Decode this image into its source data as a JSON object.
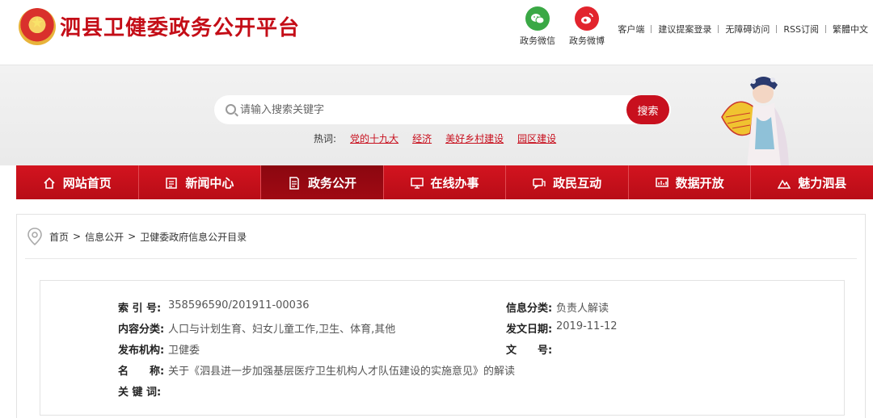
{
  "header": {
    "site_title": "泗县卫健委政务公开平台",
    "social": [
      {
        "label": "政务微信",
        "icon": "wechat-icon"
      },
      {
        "label": "政务微博",
        "icon": "weibo-icon"
      }
    ],
    "links": [
      "客户端",
      "建议提案登录",
      "无障碍访问",
      "RSS订阅",
      "繁體中文"
    ]
  },
  "search": {
    "placeholder": "请输入搜索关键字",
    "button_label": "搜索",
    "hot_label": "热词:",
    "hot_words": [
      "党的十九大",
      "经济",
      "美好乡村建设",
      "园区建设"
    ]
  },
  "nav": {
    "items": [
      {
        "label": "网站首页",
        "icon": "home-icon",
        "active": false
      },
      {
        "label": "新闻中心",
        "icon": "news-icon",
        "active": false
      },
      {
        "label": "政务公开",
        "icon": "document-icon",
        "active": true
      },
      {
        "label": "在线办事",
        "icon": "monitor-icon",
        "active": false
      },
      {
        "label": "政民互动",
        "icon": "chat-icon",
        "active": false
      },
      {
        "label": "数据开放",
        "icon": "data-icon",
        "active": false
      },
      {
        "label": "魅力泗县",
        "icon": "mountain-icon",
        "active": false
      }
    ]
  },
  "breadcrumb": {
    "items": [
      "首页",
      "信息公开",
      "卫健委政府信息公开目录"
    ],
    "separator": ">"
  },
  "meta": {
    "index_label": "索 引 号:",
    "index_value": "358596590/201911-00036",
    "category_label": "信息分类:",
    "category_value": "负责人解读",
    "content_label": "内容分类:",
    "content_value": "人口与计划生育、妇女儿童工作,卫生、体育,其他",
    "date_label": "发文日期:",
    "date_value": "2019-11-12",
    "org_label": "发布机构:",
    "org_value": "卫健委",
    "docno_label": "文　　号:",
    "docno_value": "",
    "name_label": "名　　称:",
    "name_value": "关于《泗县进一步加强基层医疗卫生机构人才队伍建设的实施意见》的解读",
    "keywords_label": "关 键 词:",
    "keywords_value": ""
  },
  "colors": {
    "brand_red": "#c8101e",
    "nav_active": "#8b0710",
    "wechat_green": "#3aa845",
    "weibo_red": "#e2242d"
  }
}
